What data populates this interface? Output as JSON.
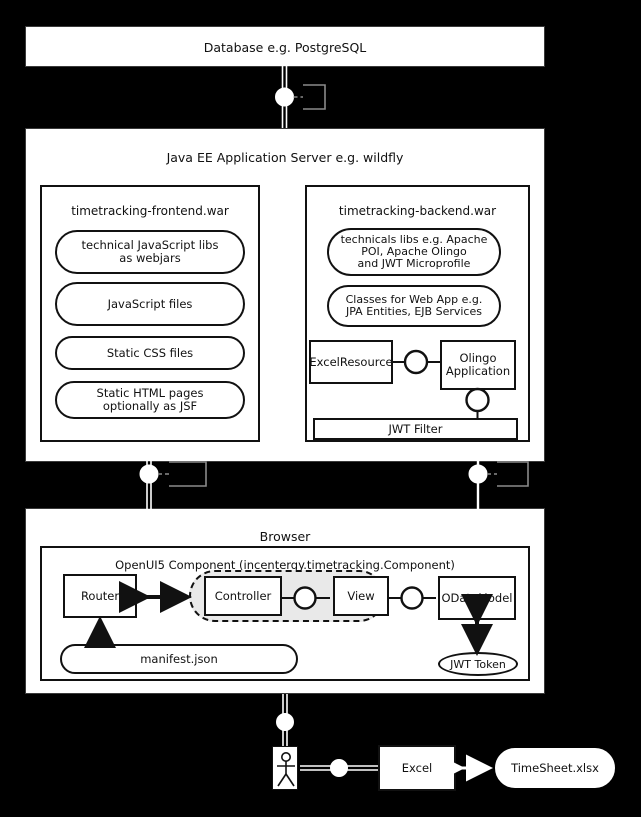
{
  "diagram": {
    "type": "architecture-component-diagram",
    "background_color": "#000000",
    "box_fill": "#ffffff",
    "line_color": "#111111",
    "mvc_group_fill": "#e9e9e9"
  },
  "database": {
    "label": "Database e.g. PostgreSQL"
  },
  "app_server": {
    "label": "Java EE Application Server e.g. wildfly",
    "frontend_war": {
      "label": "timetracking-frontend.war",
      "items": [
        "technical JavaScript libs\nas webjars",
        "JavaScript files",
        "Static CSS files",
        "Static HTML pages\noptionally as JSF"
      ],
      "item_lines": [
        [
          "technical JavaScript libs",
          "as webjars"
        ],
        [
          "JavaScript files"
        ],
        [
          "Static CSS files"
        ],
        [
          "Static HTML pages",
          "optionally as JSF"
        ]
      ]
    },
    "backend_war": {
      "label": "timetracking-backend.war",
      "items": [
        [
          "technicals libs e.g. Apache",
          "POI, Apache Olingo",
          "and JWT Microprofile"
        ],
        [
          "Classes for Web App e.g.",
          "JPA Entities, EJB Services"
        ]
      ],
      "excel_resource": "ExcelResource",
      "olingo_application": [
        "Olingo",
        "Application"
      ],
      "jwt_filter": "JWT Filter"
    }
  },
  "browser": {
    "label": "Browser",
    "component": {
      "label": "OpenUI5 Component (incentergy.timetracking.Component)",
      "router": "Router",
      "controller": "Controller",
      "view": "View",
      "odata_model": "ODataModel",
      "manifest": "manifest.json",
      "jwt_token": "JWT Token"
    }
  },
  "bottom": {
    "actor": "user-actor",
    "excel": "Excel",
    "timesheet": "TimeSheet.xlsx"
  },
  "connectors": [
    {
      "name": "database-to-appserver",
      "style": "lollipop-socket"
    },
    {
      "name": "frontend-to-browser",
      "style": "lollipop-socket"
    },
    {
      "name": "jwtfilter-to-odatamodel",
      "style": "lollipop-socket"
    },
    {
      "name": "browser-to-user",
      "style": "lollipop"
    },
    {
      "name": "user-to-excel",
      "style": "lollipop"
    },
    {
      "name": "excel-to-timesheet",
      "style": "double-arrow"
    },
    {
      "name": "excelresource-to-olingo",
      "style": "ball-joint"
    },
    {
      "name": "olingo-to-jwtfilter",
      "style": "ball-joint"
    },
    {
      "name": "controller-to-view",
      "style": "ball-joint"
    },
    {
      "name": "view-to-odatamodel",
      "style": "ball-joint"
    },
    {
      "name": "router-to-controller",
      "style": "double-arrow"
    },
    {
      "name": "manifest-to-router",
      "style": "arrow-up"
    },
    {
      "name": "odatamodel-to-jwttoken",
      "style": "double-arrow-vertical"
    }
  ]
}
